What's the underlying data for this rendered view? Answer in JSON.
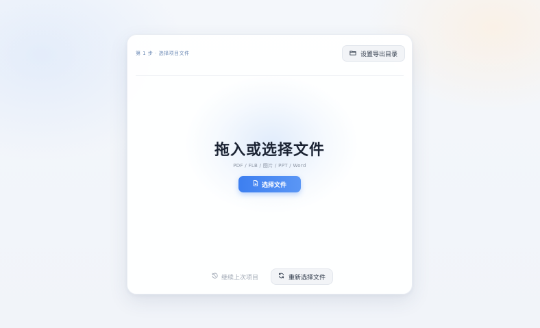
{
  "header": {
    "step_label": "第 1 步 · 选择项目文件",
    "export_button_label": "设置导出目录",
    "export_icon": "folder-icon"
  },
  "dropzone": {
    "title": "拖入或选择文件",
    "formats": "PDF / FLB / 图片 / PPT / Word",
    "choose_button_label": "选择文件",
    "choose_icon": "file-icon"
  },
  "footer": {
    "continue_label": "继续上次项目",
    "continue_icon": "history-icon",
    "reselect_label": "重新选择文件",
    "reselect_icon": "refresh-icon"
  },
  "colors": {
    "accent": "#3d7ff0",
    "title": "#1b2333",
    "step": "#6a88b4",
    "muted": "#a3abb7"
  }
}
